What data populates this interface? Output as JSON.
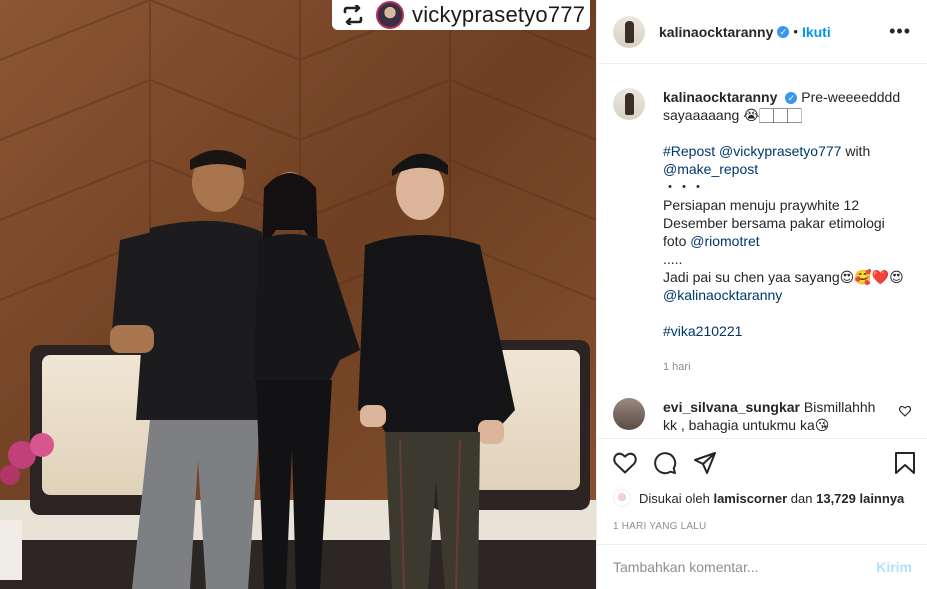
{
  "repost_tag": {
    "username": "vickyprasetyo777",
    "icon": "repost-icon"
  },
  "header": {
    "username": "kalinaocktaranny",
    "verified_icon": "verified-badge-icon",
    "separator": "•",
    "follow_label": "Ikuti",
    "more_icon": "more-options-icon",
    "more_label": "•••"
  },
  "caption": {
    "username": "kalinaocktaranny",
    "lines": {
      "first": "Pre-weeeedddd",
      "second": "sayaaaaang 😭🏻🏻🏻",
      "tag1": "#Repost",
      "mention1": "@vickyprasetyo777",
      "with": " with",
      "mention2": "@make_repost",
      "dots": "・・・",
      "p1": "Persiapan menuju praywhite 12",
      "p2": "Desember bersama pakar etimologi",
      "p3_pre": "foto ",
      "mention3": "@riomotret",
      "dots2": ".....",
      "p4": "Jadi pai su chen yaa sayang😍🥰❤️😍",
      "mention4": "@kalinaocktaranny",
      "tag2": "#vika210221"
    },
    "time_ago": "1 hari"
  },
  "comment": {
    "username": "evi_silvana_sungkar",
    "text": "Bismillahhh kk , bahagia untukmu ka😘",
    "like_icon": "heart-outline-icon"
  },
  "actions": {
    "like_icon": "heart-icon",
    "comment_icon": "comment-icon",
    "share_icon": "share-icon",
    "save_icon": "bookmark-icon"
  },
  "likes": {
    "prefix": "Disukai oleh",
    "user": "lamiscorner",
    "mid": "dan",
    "count": "13,729 lainnya"
  },
  "posted": "1 HARI YANG LALU",
  "add_comment": {
    "placeholder": "Tambahkan komentar...",
    "post_label": "Kirim"
  },
  "colors": {
    "accent": "#0095f6",
    "post_disabled": "#b2dffc",
    "link": "#00376b",
    "muted": "#8e8e8e"
  }
}
